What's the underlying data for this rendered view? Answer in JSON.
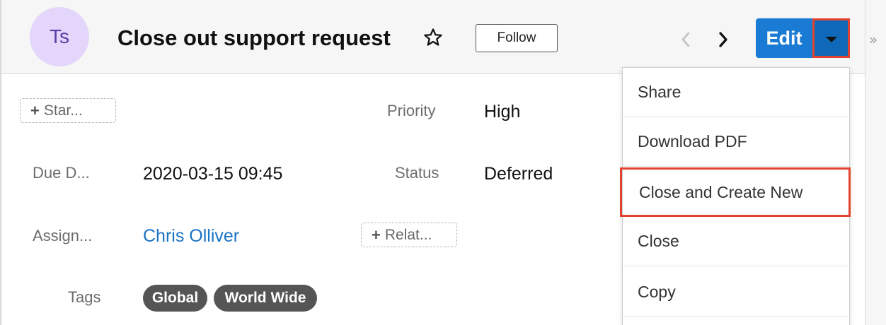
{
  "record": {
    "avatar_initials": "Ts",
    "title": "Close out support request",
    "follow_label": "Follow",
    "edit_label": "Edit"
  },
  "fields": {
    "star_button": "Star...",
    "priority_label": "Priority",
    "priority_value": "High",
    "due_date_label": "Due D...",
    "due_date_value": "2020-03-15 09:45",
    "status_label": "Status",
    "status_value": "Deferred",
    "assigned_label": "Assign...",
    "assigned_value": "Chris Olliver",
    "related_button": "Relat...",
    "tags_label": "Tags",
    "tags": [
      "Global",
      "World Wide"
    ]
  },
  "menu": {
    "items": [
      "Share",
      "Download PDF",
      "Close and Create New",
      "Close",
      "Copy"
    ],
    "highlighted": "Close and Create New"
  },
  "colors": {
    "accent": "#1a7bd4",
    "highlight_border": "#e24330",
    "avatar_bg": "#e3d6fa",
    "tag_bg": "#555555",
    "link": "#1a73c4"
  }
}
